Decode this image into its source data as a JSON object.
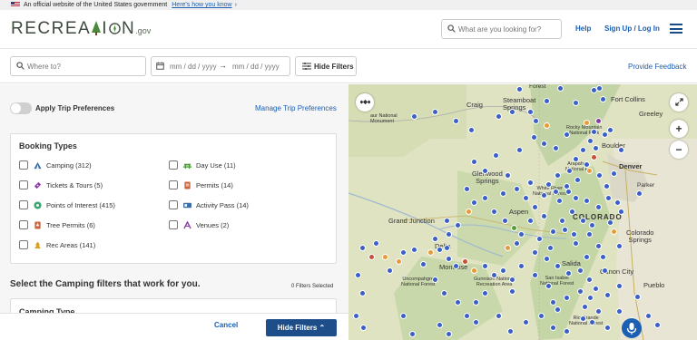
{
  "gov_banner": {
    "text": "An official website of the United States government",
    "link": "Here's how you know"
  },
  "header": {
    "logo_part1": "RECREA",
    "logo_part2": "I",
    "logo_part3": "N",
    "logo_gov": ".gov",
    "search_placeholder": "What are you looking for?",
    "help": "Help",
    "signup": "Sign Up / Log In"
  },
  "filterbar": {
    "where_placeholder": "Where to?",
    "date_start_placeholder": "mm / dd / yyyy",
    "date_end_placeholder": "mm / dd / yyyy",
    "hide_filters": "Hide Filters",
    "feedback": "Provide Feedback"
  },
  "panel": {
    "apply_trip_prefs": "Apply Trip Preferences",
    "manage_trip_prefs": "Manage Trip Preferences",
    "booking_types_title": "Booking Types",
    "booking_types": [
      {
        "label": "Camping (312)",
        "icon": "tent-icon",
        "color": "#3a6ea5"
      },
      {
        "label": "Day Use (11)",
        "icon": "picnic-table-icon",
        "color": "#4a9a3a"
      },
      {
        "label": "Tickets & Tours (5)",
        "icon": "ticket-icon",
        "color": "#8a3aa5"
      },
      {
        "label": "Permits (14)",
        "icon": "permit-icon",
        "color": "#c8643a"
      },
      {
        "label": "Points of Interest (415)",
        "icon": "poi-icon",
        "color": "#3aa56e"
      },
      {
        "label": "Activity Pass (14)",
        "icon": "pass-icon",
        "color": "#3a6ea5"
      },
      {
        "label": "Tree Permits (6)",
        "icon": "tree-permit-icon",
        "color": "#c8643a"
      },
      {
        "label": "Venues (2)",
        "icon": "venue-icon",
        "color": "#8a3aa5"
      },
      {
        "label": "Rec Areas (141)",
        "icon": "rec-area-icon",
        "color": "#d8a020"
      }
    ],
    "camping_heading": "Select the Camping filters that work for you.",
    "filters_selected": "0 Filters Selected",
    "camping_type": "Camping Type",
    "cancel": "Cancel",
    "hide_filters": "Hide Filters"
  },
  "map": {
    "labels": {
      "craig": "Craig",
      "steamboat": "Steamboat\nSprings",
      "dinosaur": "aur National\nMonument",
      "fort_collins": "Fort Collins",
      "greeley": "Greeley",
      "rmnp": "Rocky Mountain\nNational Park",
      "boulder": "Boulder",
      "denver": "Denver",
      "parker": "Parker",
      "glenwood": "Glenwood\nSprings",
      "arapaho": "Arapaho\nNational F",
      "aspen": "Aspen",
      "white_river": "White River\nNational Forest",
      "colorado": "COLORADO",
      "colorado_springs": "Colorado\nSprings",
      "grand_junction": "Grand Junction",
      "delta": "Delta",
      "montrose": "Montrose",
      "salida": "Salida",
      "canon_city": "Canon City",
      "pueblo": "Pueblo",
      "uncompahgre": "Uncompahgre\nNational Forest",
      "gunnison": "Gunnison National\nRecreation Area",
      "san_isabel": "San Isabel\nNational Forest",
      "rio_grande": "Rio Grande\nNational Forest",
      "forest_top": "Forest"
    }
  },
  "colors": {
    "accent": "#1a5fb4",
    "primary_button": "#1d4e89",
    "map_dot_blue": "#3b5fc4",
    "map_dot_orange": "#e89a3a",
    "map_dot_red": "#c8503a",
    "map_dot_green": "#5a9a3a",
    "map_dot_purple": "#8a3aa5"
  }
}
